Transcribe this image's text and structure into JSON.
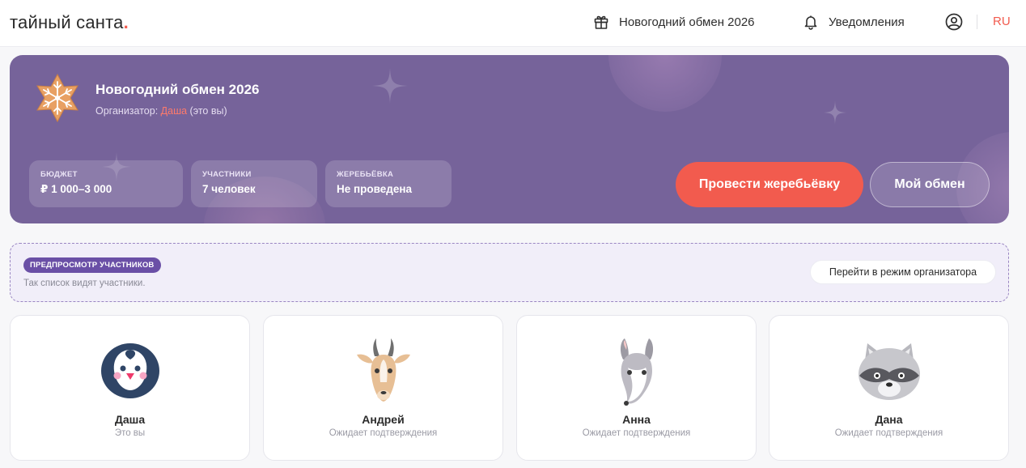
{
  "header": {
    "logo_text": "тайный санта",
    "logo_dot": ".",
    "exchange_link": "Новогодний обмен 2026",
    "notifications_link": "Уведомления",
    "language": "RU"
  },
  "hero": {
    "title": "Новогодний обмен 2026",
    "organizer_prefix": "Организатор:",
    "organizer_name": "Даша",
    "organizer_suffix": "(это вы)",
    "stats": {
      "budget_label": "БЮДЖЕТ",
      "budget_value": "₽ 1 000–3 000",
      "participants_label": "УЧАСТНИКИ",
      "participants_value": "7 человек",
      "draw_label": "ЖЕРЕБЬЁВКА",
      "draw_value": "Не проведена"
    },
    "draw_button": "Провести жеребьёвку",
    "my_exchange_button": "Мой обмен"
  },
  "preview": {
    "badge": "ПРЕДПРОСМОТР УЧАСТНИКОВ",
    "hint": "Так список видят участники.",
    "organizer_mode_button": "Перейти в режим организатора"
  },
  "participants": [
    {
      "name": "Даша",
      "status": "Это вы",
      "avatar": "penguin-icon"
    },
    {
      "name": "Андрей",
      "status": "Ожидает подтверждения",
      "avatar": "gazelle-icon"
    },
    {
      "name": "Анна",
      "status": "Ожидает подтверждения",
      "avatar": "armadillo-icon"
    },
    {
      "name": "Дана",
      "status": "Ожидает подтверждения",
      "avatar": "raccoon-icon"
    }
  ],
  "colors": {
    "accent": "#f25b4e",
    "hero_bg": "#76639a",
    "badge_bg": "#6a4fa6"
  }
}
